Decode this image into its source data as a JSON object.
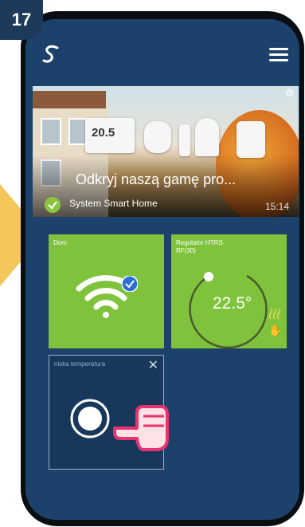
{
  "step": "17",
  "banner": {
    "title": "Odkryj naszą gamę pro...",
    "subtitle": "System Smart Home",
    "time": "15:14",
    "lcd": "20.5"
  },
  "tiles": {
    "dom": {
      "label": "Dom"
    },
    "regulator": {
      "label": "Regulator HTRS-RF(30)",
      "temperature": "22.5°"
    },
    "scene": {
      "label": "niska temperatura"
    }
  },
  "colors": {
    "accent": "#7fc33d",
    "background": "#1c416a",
    "arrow": "#f5c65a"
  }
}
